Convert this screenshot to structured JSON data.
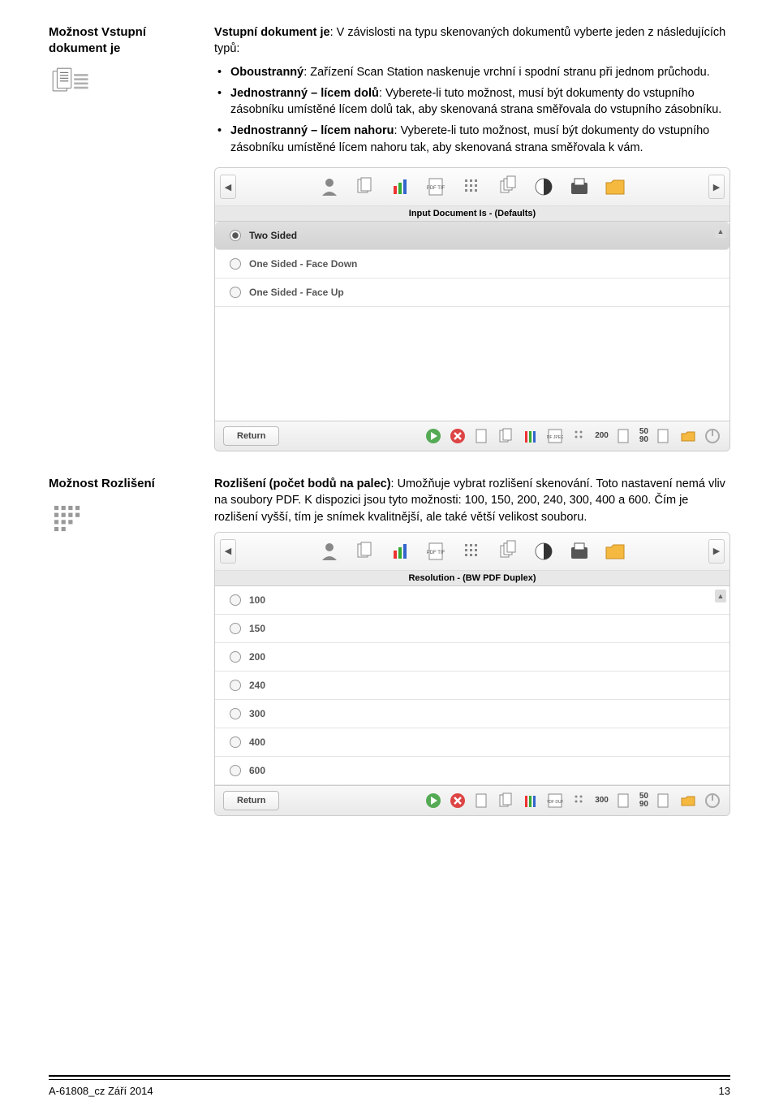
{
  "section1": {
    "heading": "Možnost Vstupní dokument je",
    "intro": "Vstupní dokument je: V závislosti na typu skenovaných dokumentů vyberte jeden z následujících typů:",
    "bullets": [
      {
        "b": "Oboustranný",
        "t": ": Zařízení Scan Station naskenuje vrchní i spodní stranu při jednom průchodu."
      },
      {
        "b": "Jednostranný – lícem dolů",
        "t": ": Vyberete-li tuto možnost, musí být dokumenty do vstupního zásobníku umístěné lícem dolů tak, aby skenovaná strana směřovala do vstupního zásobníku."
      },
      {
        "b": "Jednostranný – lícem nahoru",
        "t": ": Vyberete-li tuto možnost, musí být dokumenty do vstupního zásobníku umístěné lícem nahoru tak, aby skenovaná strana směřovala k vám."
      }
    ],
    "ui": {
      "title": "Input Document Is - (Defaults)",
      "items": [
        "Two Sided",
        "One Sided - Face Down",
        "One Sided - Face Up"
      ],
      "return": "Return",
      "bottom_num1": "200",
      "bottom_num2a": "50",
      "bottom_num2b": "90"
    }
  },
  "section2": {
    "heading": "Možnost Rozlišení",
    "para": "Rozlišení (počet bodů na palec): Umožňuje vybrat rozlišení skenování. Toto nastavení nemá vliv na soubory PDF. K dispozici jsou tyto možnosti: 100, 150, 200, 240, 300, 400 a 600. Čím je rozlišení vyšší, tím je snímek kvalitnější, ale také větší velikost souboru.",
    "para_bold": "Rozlišení (počet bodů na palec)",
    "ui": {
      "title": "Resolution - (BW PDF Duplex)",
      "items": [
        "100",
        "150",
        "200",
        "240",
        "300",
        "400",
        "600"
      ],
      "return": "Return",
      "bottom_num1": "300",
      "bottom_num2a": "50",
      "bottom_num2b": "90"
    }
  },
  "footer": {
    "left": "A-61808_cz  Září 2014",
    "right": "13"
  }
}
